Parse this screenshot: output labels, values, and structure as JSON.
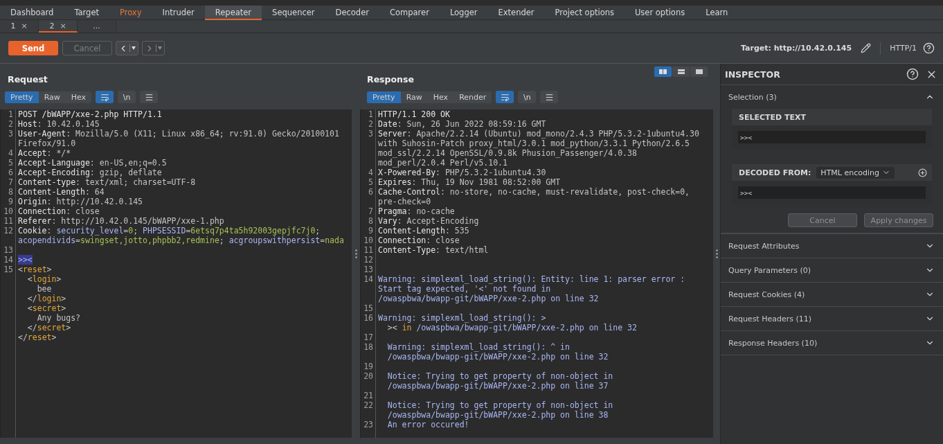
{
  "menu_tabs": [
    {
      "label": "Dashboard",
      "selected": false,
      "highlighted": false
    },
    {
      "label": "Target",
      "selected": false,
      "highlighted": false
    },
    {
      "label": "Proxy",
      "selected": false,
      "highlighted": true
    },
    {
      "label": "Intruder",
      "selected": false,
      "highlighted": false
    },
    {
      "label": "Repeater",
      "selected": true,
      "highlighted": false
    },
    {
      "label": "Sequencer",
      "selected": false,
      "highlighted": false
    },
    {
      "label": "Decoder",
      "selected": false,
      "highlighted": false
    },
    {
      "label": "Comparer",
      "selected": false,
      "highlighted": false
    },
    {
      "label": "Logger",
      "selected": false,
      "highlighted": false
    },
    {
      "label": "Extender",
      "selected": false,
      "highlighted": false
    },
    {
      "label": "Project options",
      "selected": false,
      "highlighted": false
    },
    {
      "label": "User options",
      "selected": false,
      "highlighted": false
    },
    {
      "label": "Learn",
      "selected": false,
      "highlighted": false
    }
  ],
  "repeater_tabs": [
    {
      "label": "1",
      "close": "×",
      "selected": false
    },
    {
      "label": "2",
      "close": "×",
      "selected": true
    },
    {
      "label": "...",
      "selected": false
    }
  ],
  "toolbar": {
    "send": "Send",
    "cancel": {
      "label": "Cancel",
      "disabled": true
    },
    "nav_buttons": [
      {
        "kind": "back",
        "disabled": false
      },
      {
        "kind": "forward",
        "disabled": true
      }
    ],
    "target": "Target: http://10.42.0.145",
    "protocol": "HTTP/1"
  },
  "request": {
    "title": "Request",
    "view_tabs": [
      {
        "label": "Pretty",
        "selected": true
      },
      {
        "label": "Raw",
        "selected": false
      },
      {
        "label": "Hex",
        "selected": false
      }
    ],
    "tools": [
      {
        "kind": "wrap",
        "selected": true
      },
      {
        "kind": "text",
        "label": "\\n",
        "selected": false
      },
      {
        "kind": "menu",
        "selected": false
      }
    ],
    "lines": [
      {
        "n": "1",
        "parts": [
          {
            "text": "POST /bWAPP/xxe-2.php HTTP/1.1",
            "kind": "name"
          }
        ]
      },
      {
        "n": "2",
        "parts": [
          {
            "text": "Host",
            "kind": "name"
          },
          {
            "text": ": 10.42.0.145",
            "kind": "val"
          }
        ]
      },
      {
        "n": "3",
        "parts": [
          {
            "text": "User-Agent",
            "kind": "name"
          },
          {
            "text": ": Mozilla/5.0 (X11; Linux x86_64; rv:91.0) Gecko/20100101",
            "kind": "val"
          }
        ]
      },
      {
        "parts": [
          {
            "text": "Firefox/91.0",
            "kind": "val"
          }
        ]
      },
      {
        "n": "4",
        "parts": [
          {
            "text": "Accept",
            "kind": "name"
          },
          {
            "text": ": */*",
            "kind": "val"
          }
        ]
      },
      {
        "n": "5",
        "parts": [
          {
            "text": "Accept-Language",
            "kind": "name"
          },
          {
            "text": ": en-US,en;q=0.5",
            "kind": "val"
          }
        ]
      },
      {
        "n": "6",
        "parts": [
          {
            "text": "Accept-Encoding",
            "kind": "name"
          },
          {
            "text": ": gzip, deflate",
            "kind": "val"
          }
        ]
      },
      {
        "n": "7",
        "parts": [
          {
            "text": "Content-type",
            "kind": "name"
          },
          {
            "text": ": text/xml; charset=UTF-8",
            "kind": "val"
          }
        ]
      },
      {
        "n": "8",
        "parts": [
          {
            "text": "Content-Length",
            "kind": "name"
          },
          {
            "text": ": 64",
            "kind": "val"
          }
        ]
      },
      {
        "n": "9",
        "parts": [
          {
            "text": "Origin",
            "kind": "name"
          },
          {
            "text": ": http://10.42.0.145",
            "kind": "val"
          }
        ]
      },
      {
        "n": "10",
        "parts": [
          {
            "text": "Connection",
            "kind": "name"
          },
          {
            "text": ": close",
            "kind": "val"
          }
        ]
      },
      {
        "n": "11",
        "parts": [
          {
            "text": "Referer",
            "kind": "name"
          },
          {
            "text": ": http://10.42.0.145/bWAPP/xxe-1.php",
            "kind": "val"
          }
        ]
      },
      {
        "n": "12",
        "parts": [
          {
            "text": "Cookie",
            "kind": "name"
          },
          {
            "text": ": ",
            "kind": "val"
          },
          {
            "text": "security_level",
            "kind": "ckey"
          },
          {
            "text": "=",
            "kind": "val"
          },
          {
            "text": "0",
            "kind": "cval"
          },
          {
            "text": "; ",
            "kind": "val"
          },
          {
            "text": "PHPSESSID",
            "kind": "ckey"
          },
          {
            "text": "=",
            "kind": "val"
          },
          {
            "text": "6etsq7p4ta5h92003gepjfc7j0",
            "kind": "cval"
          },
          {
            "text": ";",
            "kind": "val"
          }
        ]
      },
      {
        "parts": [
          {
            "text": "acopendivids",
            "kind": "ckey"
          },
          {
            "text": "=",
            "kind": "val"
          },
          {
            "text": "swingset,jotto,phpbb2,redmine",
            "kind": "cval"
          },
          {
            "text": "; ",
            "kind": "val"
          },
          {
            "text": "acgroupswithpersist",
            "kind": "ckey"
          },
          {
            "text": "=",
            "kind": "val"
          },
          {
            "text": "nada",
            "kind": "cval"
          }
        ]
      },
      {
        "n": "13"
      },
      {
        "n": "14",
        "parts": [
          {
            "text": ">><",
            "kind": "sel"
          }
        ]
      },
      {
        "n": "15",
        "parts": [
          {
            "text": "<",
            "kind": "val"
          },
          {
            "text": "reset",
            "kind": "tag"
          },
          {
            "text": ">",
            "kind": "val"
          }
        ]
      },
      {
        "parts": [
          {
            "text": "  <",
            "kind": "val"
          },
          {
            "text": "login",
            "kind": "tag"
          },
          {
            "text": ">",
            "kind": "val"
          }
        ]
      },
      {
        "parts": [
          {
            "text": "    bee",
            "kind": "val"
          }
        ]
      },
      {
        "parts": [
          {
            "text": "  </",
            "kind": "val"
          },
          {
            "text": "login",
            "kind": "tag"
          },
          {
            "text": ">",
            "kind": "val"
          }
        ]
      },
      {
        "parts": [
          {
            "text": "  <",
            "kind": "val"
          },
          {
            "text": "secret",
            "kind": "tag"
          },
          {
            "text": ">",
            "kind": "val"
          }
        ]
      },
      {
        "parts": [
          {
            "text": "    Any bugs?",
            "kind": "val"
          }
        ]
      },
      {
        "parts": [
          {
            "text": "  </",
            "kind": "val"
          },
          {
            "text": "secret",
            "kind": "tag"
          },
          {
            "text": ">",
            "kind": "val"
          }
        ]
      },
      {
        "parts": [
          {
            "text": "</",
            "kind": "val"
          },
          {
            "text": "reset",
            "kind": "tag"
          },
          {
            "text": ">",
            "kind": "val"
          }
        ]
      }
    ]
  },
  "response": {
    "title": "Response",
    "layout_buttons": [
      {
        "kind": "columns",
        "selected": true
      },
      {
        "kind": "rows",
        "selected": false
      },
      {
        "kind": "single",
        "selected": false
      }
    ],
    "view_tabs": [
      {
        "label": "Pretty",
        "selected": true
      },
      {
        "label": "Raw",
        "selected": false
      },
      {
        "label": "Hex",
        "selected": false
      },
      {
        "label": "Render",
        "selected": false
      }
    ],
    "tools": [
      {
        "kind": "wrap",
        "selected": true
      },
      {
        "kind": "text",
        "label": "\\n",
        "selected": false
      },
      {
        "kind": "menu",
        "selected": false
      }
    ],
    "lines": [
      {
        "n": "1",
        "parts": [
          {
            "text": "HTTP/1.1 200 OK",
            "kind": "name"
          }
        ]
      },
      {
        "n": "2",
        "parts": [
          {
            "text": "Date",
            "kind": "name"
          },
          {
            "text": ": Sun, 26 Jun 2022 08:59:16 GMT",
            "kind": "val"
          }
        ]
      },
      {
        "n": "3",
        "parts": [
          {
            "text": "Server",
            "kind": "name"
          },
          {
            "text": ": Apache/2.2.14 (Ubuntu) mod_mono/2.4.3 PHP/5.3.2-1ubuntu4.30",
            "kind": "val"
          }
        ]
      },
      {
        "parts": [
          {
            "text": "with Suhosin-Patch proxy_html/3.0.1 mod_python/3.3.1 Python/2.6.5",
            "kind": "val"
          }
        ]
      },
      {
        "parts": [
          {
            "text": "mod_ssl/2.2.14 OpenSSL/0.9.8k Phusion_Passenger/4.0.38",
            "kind": "val"
          }
        ]
      },
      {
        "parts": [
          {
            "text": "mod_perl/2.0.4 Perl/v5.10.1",
            "kind": "val"
          }
        ]
      },
      {
        "n": "4",
        "parts": [
          {
            "text": "X-Powered-By",
            "kind": "name"
          },
          {
            "text": ": PHP/5.3.2-1ubuntu4.30",
            "kind": "val"
          }
        ]
      },
      {
        "n": "5",
        "parts": [
          {
            "text": "Expires",
            "kind": "name"
          },
          {
            "text": ": Thu, 19 Nov 1981 08:52:00 GMT",
            "kind": "val"
          }
        ]
      },
      {
        "n": "6",
        "parts": [
          {
            "text": "Cache-Control",
            "kind": "name"
          },
          {
            "text": ": no-store, no-cache, must-revalidate, post-check=0,",
            "kind": "val"
          }
        ]
      },
      {
        "parts": [
          {
            "text": "pre-check=0",
            "kind": "val"
          }
        ]
      },
      {
        "n": "7",
        "parts": [
          {
            "text": "Pragma",
            "kind": "name"
          },
          {
            "text": ": no-cache",
            "kind": "val"
          }
        ]
      },
      {
        "n": "8",
        "parts": [
          {
            "text": "Vary",
            "kind": "name"
          },
          {
            "text": ": Accept-Encoding",
            "kind": "val"
          }
        ]
      },
      {
        "n": "9",
        "parts": [
          {
            "text": "Content-Length",
            "kind": "name"
          },
          {
            "text": ": 535",
            "kind": "val"
          }
        ]
      },
      {
        "n": "10",
        "parts": [
          {
            "text": "Connection",
            "kind": "name"
          },
          {
            "text": ": close",
            "kind": "val"
          }
        ]
      },
      {
        "n": "11",
        "parts": [
          {
            "text": "Content-Type",
            "kind": "name"
          },
          {
            "text": ": text/html",
            "kind": "val"
          }
        ]
      },
      {
        "n": "12"
      },
      {
        "n": "13"
      },
      {
        "n": "14",
        "parts": [
          {
            "text": "Warning: simplexml_load_string(): Entity: line 1: parser error :",
            "kind": "msg"
          }
        ]
      },
      {
        "parts": [
          {
            "text": "Start tag expected, '<' not found in",
            "kind": "msg"
          }
        ]
      },
      {
        "parts": [
          {
            "text": "/owaspbwa/bwapp-git/bWAPP/xxe-2.php on line 32",
            "kind": "msg"
          }
        ]
      },
      {
        "n": "15"
      },
      {
        "n": "16",
        "parts": [
          {
            "text": "Warning: simplexml_load_string(): >",
            "kind": "msg"
          }
        ]
      },
      {
        "parts": [
          {
            "text": "  ><",
            "kind": "val"
          },
          {
            "text": " in",
            "kind": "kw"
          },
          {
            "text": " /owaspbwa/bwapp-git/bWAPP/xxe-2.php on line 32",
            "kind": "msg"
          }
        ]
      },
      {
        "n": "17"
      },
      {
        "n": "18",
        "parts": [
          {
            "text": "  Warning: simplexml_load_string(): ^ in",
            "kind": "msg"
          }
        ]
      },
      {
        "parts": [
          {
            "text": "  /owaspbwa/bwapp-git/bWAPP/xxe-2.php on line 32",
            "kind": "msg"
          }
        ]
      },
      {
        "n": "19"
      },
      {
        "n": "20",
        "parts": [
          {
            "text": "  Notice: Trying to get property of non-object in",
            "kind": "msg"
          }
        ]
      },
      {
        "parts": [
          {
            "text": "  /owaspbwa/bwapp-git/bWAPP/xxe-2.php on line 37",
            "kind": "msg"
          }
        ]
      },
      {
        "n": "21"
      },
      {
        "n": "22",
        "parts": [
          {
            "text": "  Notice: Trying to get property of non-object in",
            "kind": "msg"
          }
        ]
      },
      {
        "parts": [
          {
            "text": "  /owaspbwa/bwapp-git/bWAPP/xxe-2.php on line 38",
            "kind": "msg"
          }
        ]
      },
      {
        "n": "23",
        "parts": [
          {
            "text": "  An error occured!",
            "kind": "msg"
          }
        ]
      }
    ]
  },
  "inspector": {
    "title": "INSPECTOR",
    "selection": {
      "label": "Selection (3)",
      "expanded": true,
      "selected_text": {
        "label": "SELECTED TEXT",
        "value": ">><"
      },
      "decoded": {
        "label": "DECODED FROM:",
        "encoding": "HTML encoding",
        "value": ">><"
      },
      "buttons": [
        "Cancel",
        "Apply changes"
      ]
    },
    "sections": [
      {
        "label": "Request Attributes",
        "expanded": false
      },
      {
        "label": "Query Parameters (0)",
        "expanded": false
      },
      {
        "label": "Request Cookies (4)",
        "expanded": false
      },
      {
        "label": "Request Headers (11)",
        "expanded": false
      },
      {
        "label": "Response Headers (10)",
        "expanded": false
      }
    ]
  }
}
